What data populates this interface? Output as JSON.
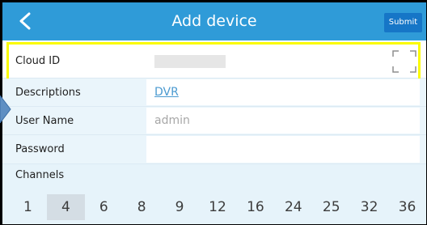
{
  "header": {
    "title": "Add device",
    "submit_label": "Submit",
    "back_icon": "chevron-left-icon"
  },
  "form": {
    "cloud_id": {
      "label": "Cloud ID",
      "value": "",
      "scan_icon": "scan-frame-icon"
    },
    "descriptions": {
      "label": "Descriptions",
      "value": "DVR"
    },
    "user_name": {
      "label": "User Name",
      "value": "admin"
    },
    "password": {
      "label": "Password",
      "value": ""
    }
  },
  "channels": {
    "label": "Channels",
    "options": [
      "1",
      "4",
      "6",
      "8",
      "9",
      "12",
      "16",
      "24",
      "25",
      "32",
      "36"
    ],
    "selected": "4"
  },
  "colors": {
    "header_bg": "#2f9bd8",
    "submit_bg": "#1676c7",
    "highlight": "#fbfb03",
    "row_bg": "#eaf5fb",
    "link": "#4b9ad0"
  }
}
